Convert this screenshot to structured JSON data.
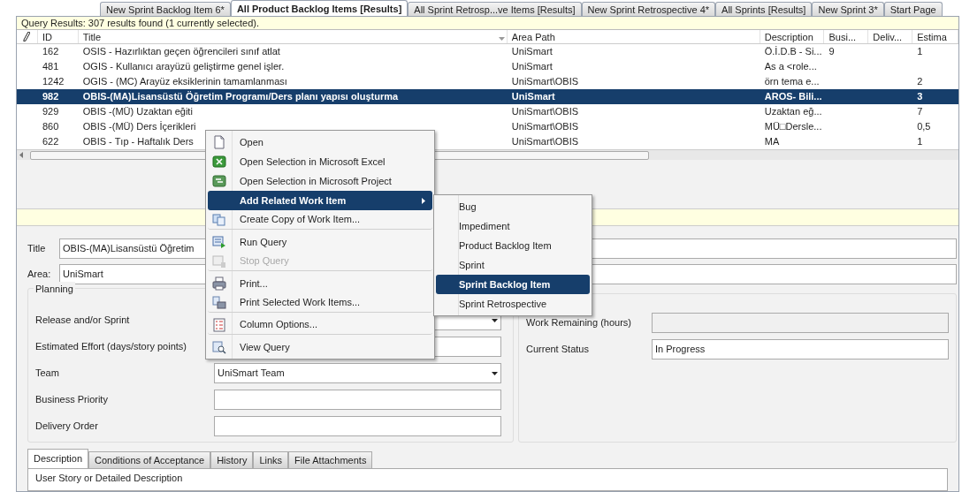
{
  "tabs": [
    {
      "label": "New Sprint Backlog Item 6*",
      "selected": false
    },
    {
      "label": "All Product Backlog Items [Results]",
      "selected": true
    },
    {
      "label": "All Sprint Retrosp...ve Items [Results]",
      "selected": false
    },
    {
      "label": "New Sprint Retrospective 4*",
      "selected": false
    },
    {
      "label": "All Sprints [Results]",
      "selected": false
    },
    {
      "label": "New Sprint 3*",
      "selected": false
    },
    {
      "label": "Start Page",
      "selected": false
    }
  ],
  "query_status": "Query Results: 307 results found (1 currently selected).",
  "table": {
    "columns": [
      "ID",
      "Title",
      "Area Path",
      "Description",
      "Busi...",
      "Deliv...",
      "Estima"
    ],
    "rows": [
      {
        "id": "162",
        "title": "OSIS - Hazırlıktan geçen öğrencileri sınıf atlat",
        "area_path": "UniSmart",
        "description": "Ö.İ.D.B - Si...",
        "business": "9",
        "estimate": "1",
        "selected": false
      },
      {
        "id": "481",
        "title": "OGIS - Kullanıcı arayüzü geliştirme genel işler.",
        "area_path": "UniSmart",
        "description": "As a <role...",
        "business": "",
        "estimate": "",
        "selected": false
      },
      {
        "id": "1242",
        "title": "OGIS - (MC) Arayüz eksiklerinin tamamlanması",
        "area_path": "UniSmart\\OBIS",
        "description": "örn tema e...",
        "business": "",
        "estimate": "2",
        "selected": false
      },
      {
        "id": "982",
        "title": "OBIS-(MA)Lisansüstü Öğretim Programı/Ders planı yapısı oluşturma",
        "area_path": "UniSmart",
        "description": "AROS- Bili...",
        "business": "",
        "estimate": "3",
        "selected": true
      },
      {
        "id": "929",
        "title": "OBIS -(MÜ) Uzaktan eğiti",
        "area_path": "UniSmart\\OBIS",
        "description": "Uzaktan eğ...",
        "business": "",
        "estimate": "7",
        "selected": false
      },
      {
        "id": "860",
        "title": "OBIS -(MÜ) Ders İçerikleri",
        "area_path": "UniSmart\\OBIS",
        "description": "MÜ□Dersle...",
        "business": "",
        "estimate": "0,5",
        "selected": false
      },
      {
        "id": "622",
        "title": "OBIS - Tıp - Haftalık Ders",
        "area_path": "UniSmart\\OBIS",
        "description": "MA",
        "business": "",
        "estimate": "1",
        "selected": false
      }
    ]
  },
  "form": {
    "title_label": "Title",
    "title_value": "OBIS-(MA)Lisansüstü Öğretim",
    "area_label": "Area:",
    "area_value": "UniSmart",
    "planning": {
      "legend": "Planning",
      "fields": [
        {
          "label": "Release and/or Sprint",
          "kind": "dropdown"
        },
        {
          "label": "Estimated Effort (days/story points)",
          "kind": "text"
        },
        {
          "label": "Team",
          "value": "UniSmart Team",
          "kind": "dropdown"
        },
        {
          "label": "Business Priority",
          "kind": "text"
        },
        {
          "label": "Delivery Order",
          "kind": "text"
        }
      ]
    },
    "status_fields": [
      {
        "label": "Work Remaining (hours)",
        "disabled": true
      },
      {
        "label": "Current Status",
        "value": "In Progress",
        "disabled": false
      }
    ],
    "bottom_tabs": [
      {
        "label": "Description",
        "selected": true
      },
      {
        "label": "Conditions of Acceptance",
        "selected": false
      },
      {
        "label": "History",
        "selected": false
      },
      {
        "label": "Links",
        "selected": false
      },
      {
        "label": "File Attachments",
        "selected": false
      }
    ],
    "description_heading": "User Story or Detailed Description"
  },
  "context_menu": {
    "items": [
      {
        "label": "Open",
        "selected": false,
        "disabled": false,
        "submenu": false,
        "separator_after": false
      },
      {
        "label": "Open Selection in Microsoft Excel",
        "selected": false,
        "disabled": false,
        "submenu": false,
        "separator_after": false
      },
      {
        "label": "Open Selection in Microsoft Project",
        "selected": false,
        "disabled": false,
        "submenu": false,
        "separator_after": false
      },
      {
        "label": "Add Related Work Item",
        "selected": true,
        "disabled": false,
        "submenu": true,
        "separator_after": false
      },
      {
        "label": "Create Copy of Work Item...",
        "selected": false,
        "disabled": false,
        "submenu": false,
        "separator_after": true
      },
      {
        "label": "Run Query",
        "selected": false,
        "disabled": false,
        "submenu": false,
        "separator_after": false
      },
      {
        "label": "Stop Query",
        "selected": false,
        "disabled": true,
        "submenu": false,
        "separator_after": true
      },
      {
        "label": "Print...",
        "selected": false,
        "disabled": false,
        "submenu": false,
        "separator_after": false
      },
      {
        "label": "Print Selected Work Items...",
        "selected": false,
        "disabled": false,
        "submenu": false,
        "separator_after": true
      },
      {
        "label": "Column Options...",
        "selected": false,
        "disabled": false,
        "submenu": false,
        "separator_after": true
      },
      {
        "label": "View Query",
        "selected": false,
        "disabled": false,
        "submenu": false,
        "separator_after": false
      }
    ],
    "submenu": [
      {
        "label": "Bug",
        "selected": false
      },
      {
        "label": "Impediment",
        "selected": false
      },
      {
        "label": "Product Backlog Item",
        "selected": false
      },
      {
        "label": "Sprint",
        "selected": false
      },
      {
        "label": "Sprint Backlog Item",
        "selected": true
      },
      {
        "label": "Sprint Retrospective",
        "selected": false
      }
    ]
  }
}
